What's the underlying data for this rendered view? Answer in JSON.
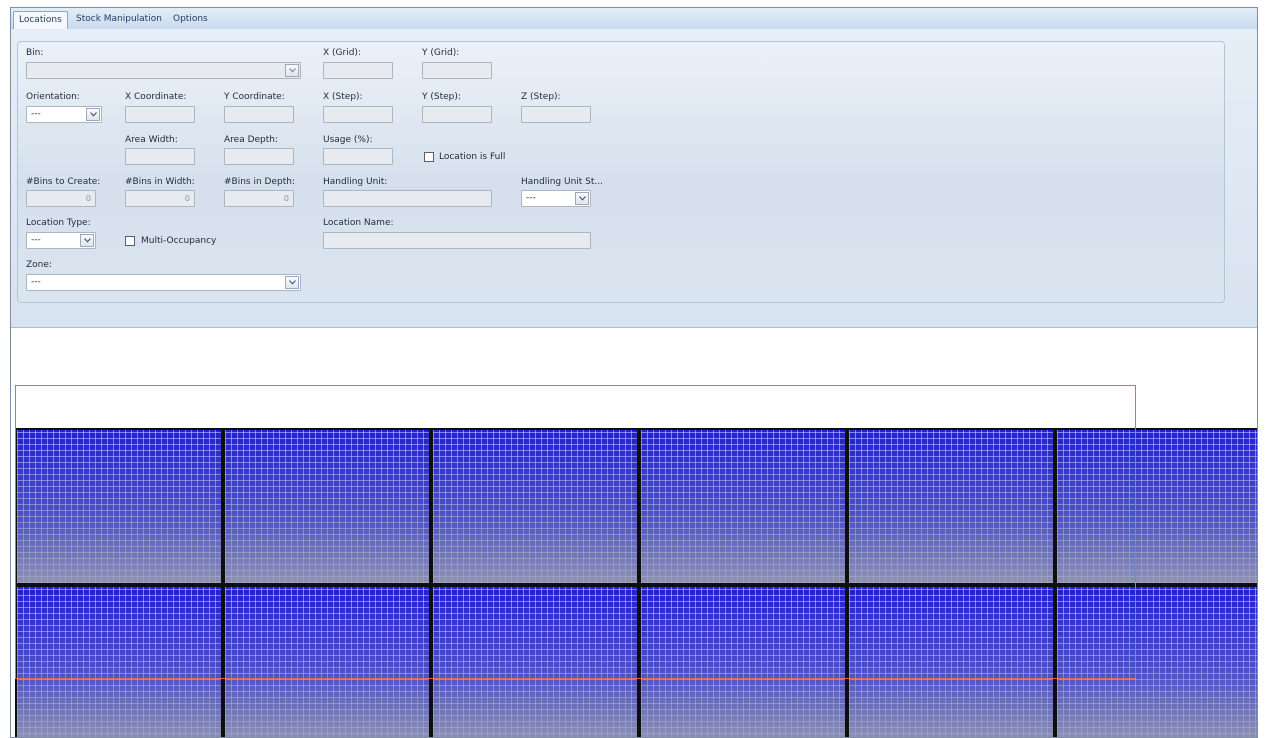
{
  "tabs": [
    {
      "label": "Locations",
      "active": true
    },
    {
      "label": "Stock Manipulation",
      "active": false
    },
    {
      "label": "Options",
      "active": false
    }
  ],
  "form": {
    "bin": {
      "label": "Bin:",
      "value": ""
    },
    "x_grid": {
      "label": "X (Grid):",
      "value": ""
    },
    "y_grid": {
      "label": "Y (Grid):",
      "value": ""
    },
    "orientation": {
      "label": "Orientation:",
      "value": "---"
    },
    "x_coordinate": {
      "label": "X Coordinate:",
      "value": ""
    },
    "y_coordinate": {
      "label": "Y Coordinate:",
      "value": ""
    },
    "x_step": {
      "label": "X (Step):",
      "value": ""
    },
    "y_step": {
      "label": "Y (Step):",
      "value": ""
    },
    "z_step": {
      "label": "Z (Step):",
      "value": ""
    },
    "area_width": {
      "label": "Area Width:",
      "value": ""
    },
    "area_depth": {
      "label": "Area Depth:",
      "value": ""
    },
    "usage": {
      "label": "Usage (%):",
      "value": ""
    },
    "location_is_full": {
      "label": "Location is Full",
      "checked": false
    },
    "bins_to_create": {
      "label": "#Bins to Create:",
      "value": "0"
    },
    "bins_in_width": {
      "label": "#Bins in Width:",
      "value": "0"
    },
    "bins_in_depth": {
      "label": "#Bins in Depth:",
      "value": "0"
    },
    "handling_unit": {
      "label": "Handling Unit:",
      "value": ""
    },
    "handling_unit_status": {
      "label": "Handling Unit St...",
      "value": "---"
    },
    "location_type": {
      "label": "Location Type:",
      "value": "---"
    },
    "multi_occupancy": {
      "label": "Multi-Occupancy",
      "checked": false
    },
    "location_name": {
      "label": "Location Name:",
      "value": ""
    },
    "zone": {
      "label": "Zone:",
      "value": "---"
    }
  },
  "colors": {
    "bin_fill": "#2020d6",
    "selection_outline": "#e46a4a",
    "pane_background": "#dde7f2"
  },
  "icons": {
    "dropdown": "chevron-down-icon"
  },
  "layout_grid": {
    "columns": 6,
    "rows": 2
  }
}
